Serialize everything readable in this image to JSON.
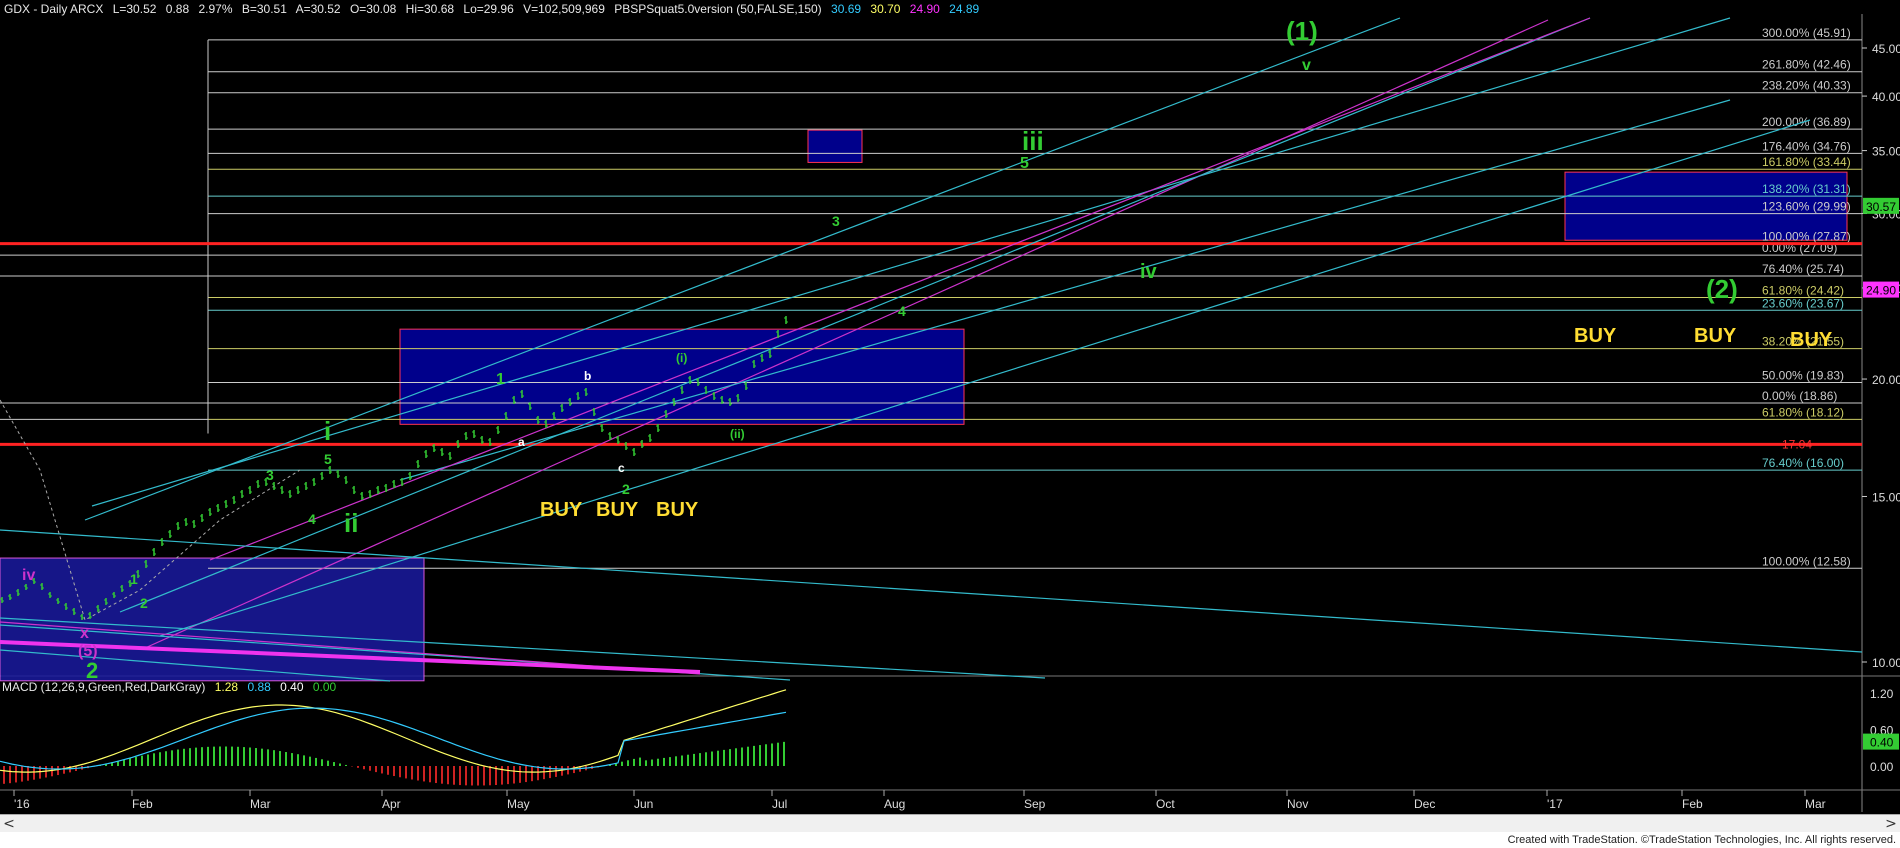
{
  "header": {
    "symbol": "GDX - Daily  ARCX",
    "last": "L=30.52",
    "change": "0.88",
    "change_pct": "2.97%",
    "bid": "B=30.51",
    "ask": "A=30.52",
    "open": "O=30.08",
    "high": "Hi=30.68",
    "low": "Lo=29.96",
    "volume": "V=102,509,969",
    "indicator": "PBSPSquat5.0version (50,FALSE,150)",
    "ind_values": [
      "30.69",
      "30.70",
      "24.90",
      "24.89"
    ],
    "ind_colors": [
      "#33ccff",
      "#ffff66",
      "#ff33ff",
      "#33ccff"
    ]
  },
  "macd_header": {
    "label": "MACD (12,26,9,Green,Red,DarkGray)",
    "values": [
      "1.28",
      "0.88",
      "0.40",
      "0.00"
    ],
    "colors": [
      "#ffff66",
      "#33ccff",
      "#ffffff",
      "#33cc33"
    ]
  },
  "footer": {
    "text": "Created with TradeStation. ©TradeStation Technologies, Inc. All rights reserved."
  },
  "scrollbar": {
    "left_arrow": "<",
    "right_arrow": ">"
  },
  "chart_data": {
    "type": "candlestick",
    "xlabels": [
      "'16",
      "Feb",
      "Mar",
      "Apr",
      "May",
      "Jun",
      "Jul",
      "Aug",
      "Sep",
      "Oct",
      "Nov",
      "Dec",
      "'17",
      "Feb",
      "Mar"
    ],
    "yticks": [
      "45.00",
      "40.00",
      "35.00",
      "30.00",
      "25.00",
      "20.00",
      "15.00",
      "10.00"
    ],
    "y_scale": "log",
    "ylim": [
      9.2,
      48
    ],
    "last_price_tag": "30.57",
    "secondary_price_tag": "24.90",
    "red_level_tag": "17.04",
    "fib_levels": [
      {
        "label": "300.00% (45.91)",
        "price": 45.91
      },
      {
        "label": "261.80% (42.46)",
        "price": 42.46
      },
      {
        "label": "238.20% (40.33)",
        "price": 40.33
      },
      {
        "label": "200.00% (36.89)",
        "price": 36.89
      },
      {
        "label": "176.40% (34.76)",
        "price": 34.76
      },
      {
        "label": "161.80% (33.44)",
        "price": 33.44
      },
      {
        "label": "138.20% (31.31)",
        "price": 31.31
      },
      {
        "label": "123.60% (29.99)",
        "price": 29.99
      },
      {
        "label": "100.00% (27.87)",
        "price": 27.87
      },
      {
        "label": "0.00% (27.09)",
        "price": 27.09
      },
      {
        "label": "76.40% (25.74)",
        "price": 25.74
      },
      {
        "label": "61.80% (24.42)",
        "price": 24.42
      },
      {
        "label": "23.60% (23.67)",
        "price": 23.67
      },
      {
        "label": "38.20% (21.55)",
        "price": 21.55
      },
      {
        "label": "50.00% (19.83)",
        "price": 19.83
      },
      {
        "label": "0.00% (18.86)",
        "price": 18.86
      },
      {
        "label": "61.80% (18.12)",
        "price": 18.12
      },
      {
        "label": "76.40% (16.00)",
        "price": 16.0
      },
      {
        "label": "100.00% (12.58)",
        "price": 12.58
      }
    ],
    "wave_labels": [
      {
        "text": "(1)",
        "color": "#33cc33"
      },
      {
        "text": "v",
        "color": "#33cc33"
      },
      {
        "text": "iii",
        "color": "#33cc33"
      },
      {
        "text": "5",
        "color": "#33cc33"
      },
      {
        "text": "iv",
        "color": "#33cc33"
      },
      {
        "text": "3",
        "color": "#33cc33"
      },
      {
        "text": "4",
        "color": "#33cc33"
      },
      {
        "text": "(2)",
        "color": "#33cc33"
      },
      {
        "text": "i",
        "color": "#33cc33"
      },
      {
        "text": "ii",
        "color": "#33cc33"
      },
      {
        "text": "1",
        "color": "#33cc33"
      },
      {
        "text": "2",
        "color": "#33cc33"
      },
      {
        "text": "5",
        "color": "#33cc33"
      },
      {
        "text": "3",
        "color": "#33cc33"
      },
      {
        "text": "4",
        "color": "#33cc33"
      },
      {
        "text": "1",
        "color": "#33cc33"
      },
      {
        "text": "2",
        "color": "#33cc33"
      },
      {
        "text": "a",
        "color": "#ffffff"
      },
      {
        "text": "b",
        "color": "#ffffff"
      },
      {
        "text": "c",
        "color": "#ffffff"
      },
      {
        "text": "(i)",
        "color": "#33cc33"
      },
      {
        "text": "(ii)",
        "color": "#33cc33"
      },
      {
        "text": "iv",
        "color": "#cc33cc"
      },
      {
        "text": "x",
        "color": "#cc33cc"
      },
      {
        "text": "(5)",
        "color": "#cc33cc"
      },
      {
        "text": "2",
        "color": "#33cc33"
      }
    ],
    "buy_labels": [
      "BUY",
      "BUY",
      "BUY",
      "BUY",
      "BUY",
      "BUY"
    ],
    "macd_yticks": [
      "1.20",
      "0.60",
      "0.40",
      "0.00"
    ]
  }
}
